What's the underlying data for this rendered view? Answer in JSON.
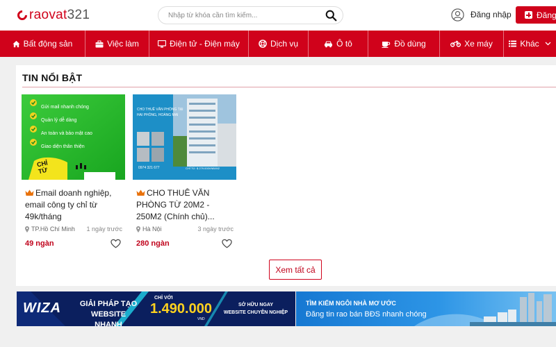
{
  "header": {
    "logo": {
      "brand": "raovat",
      "number": "321"
    },
    "search": {
      "placeholder": "Nhập từ khóa cần tìm kiếm...",
      "value": ""
    },
    "login_label": "Đăng nhập",
    "post_label": "Đăng"
  },
  "nav": {
    "items": [
      {
        "label": "Bất động sản",
        "icon": "home-icon"
      },
      {
        "label": "Việc làm",
        "icon": "briefcase-icon"
      },
      {
        "label": "Điện tử - Điện máy",
        "icon": "monitor-icon"
      },
      {
        "label": "Dịch vụ",
        "icon": "lifebuoy-icon"
      },
      {
        "label": "Ô tô",
        "icon": "car-icon"
      },
      {
        "label": "Đồ dùng",
        "icon": "cup-icon"
      },
      {
        "label": "Xe máy",
        "icon": "motorbike-icon"
      },
      {
        "label": "Khác",
        "icon": "list-icon"
      }
    ]
  },
  "featured": {
    "title": "TIN NỔI BẬT",
    "cards": [
      {
        "title": "Email doanh nghiệp, email công ty chỉ từ 49k/tháng",
        "location": "TP.Hồ Chí Minh",
        "time": "1 ngày trước",
        "price": "49 ngàn",
        "thumb": {
          "features": [
            "Gửi mail nhanh chóng",
            "Quản lý dễ dàng",
            "An toàn và bảo mật cao",
            "Giao diện thân thiện"
          ],
          "badge": "CHỈ TỪ"
        }
      },
      {
        "title": "CHO THUÊ VĂN PHÒNG TỪ 20M2 - 250M2 (Chính chủ)...",
        "location": "Hà Nội",
        "time": "3 ngày trước",
        "price": "280 ngàn",
        "thumb": {
          "line1": "CHO THUÊ VĂN PHÒNG TẠI",
          "line2": "HAI PHÒNG, HOÀNG MAI",
          "phone": "0974 321 677",
          "rate": "CHỈ TỪ: $ 279.000VNĐ/M2"
        }
      }
    ],
    "see_all": "Xem tất cả"
  },
  "banners": {
    "left": {
      "brand": "WIZA",
      "line1": "GIẢI PHÁP TẠO",
      "line2": "WEBSITE NHANH",
      "price_prefix": "CHỈ VỚI",
      "price": "1.490.000",
      "currency": "VND",
      "cta1": "SỞ HỮU NGAY",
      "cta2": "WEBSITE CHUYÊN NGHIỆP"
    },
    "right": {
      "line1": "TÌM KIẾM NGÔI NHÀ MƠ ƯỚC",
      "line2": "Đăng tin rao bán BĐS nhanh chóng"
    }
  },
  "colors": {
    "brand_red": "#d0021b",
    "price_red": "#c0021b",
    "banner_navy": "#0a1f5c"
  }
}
